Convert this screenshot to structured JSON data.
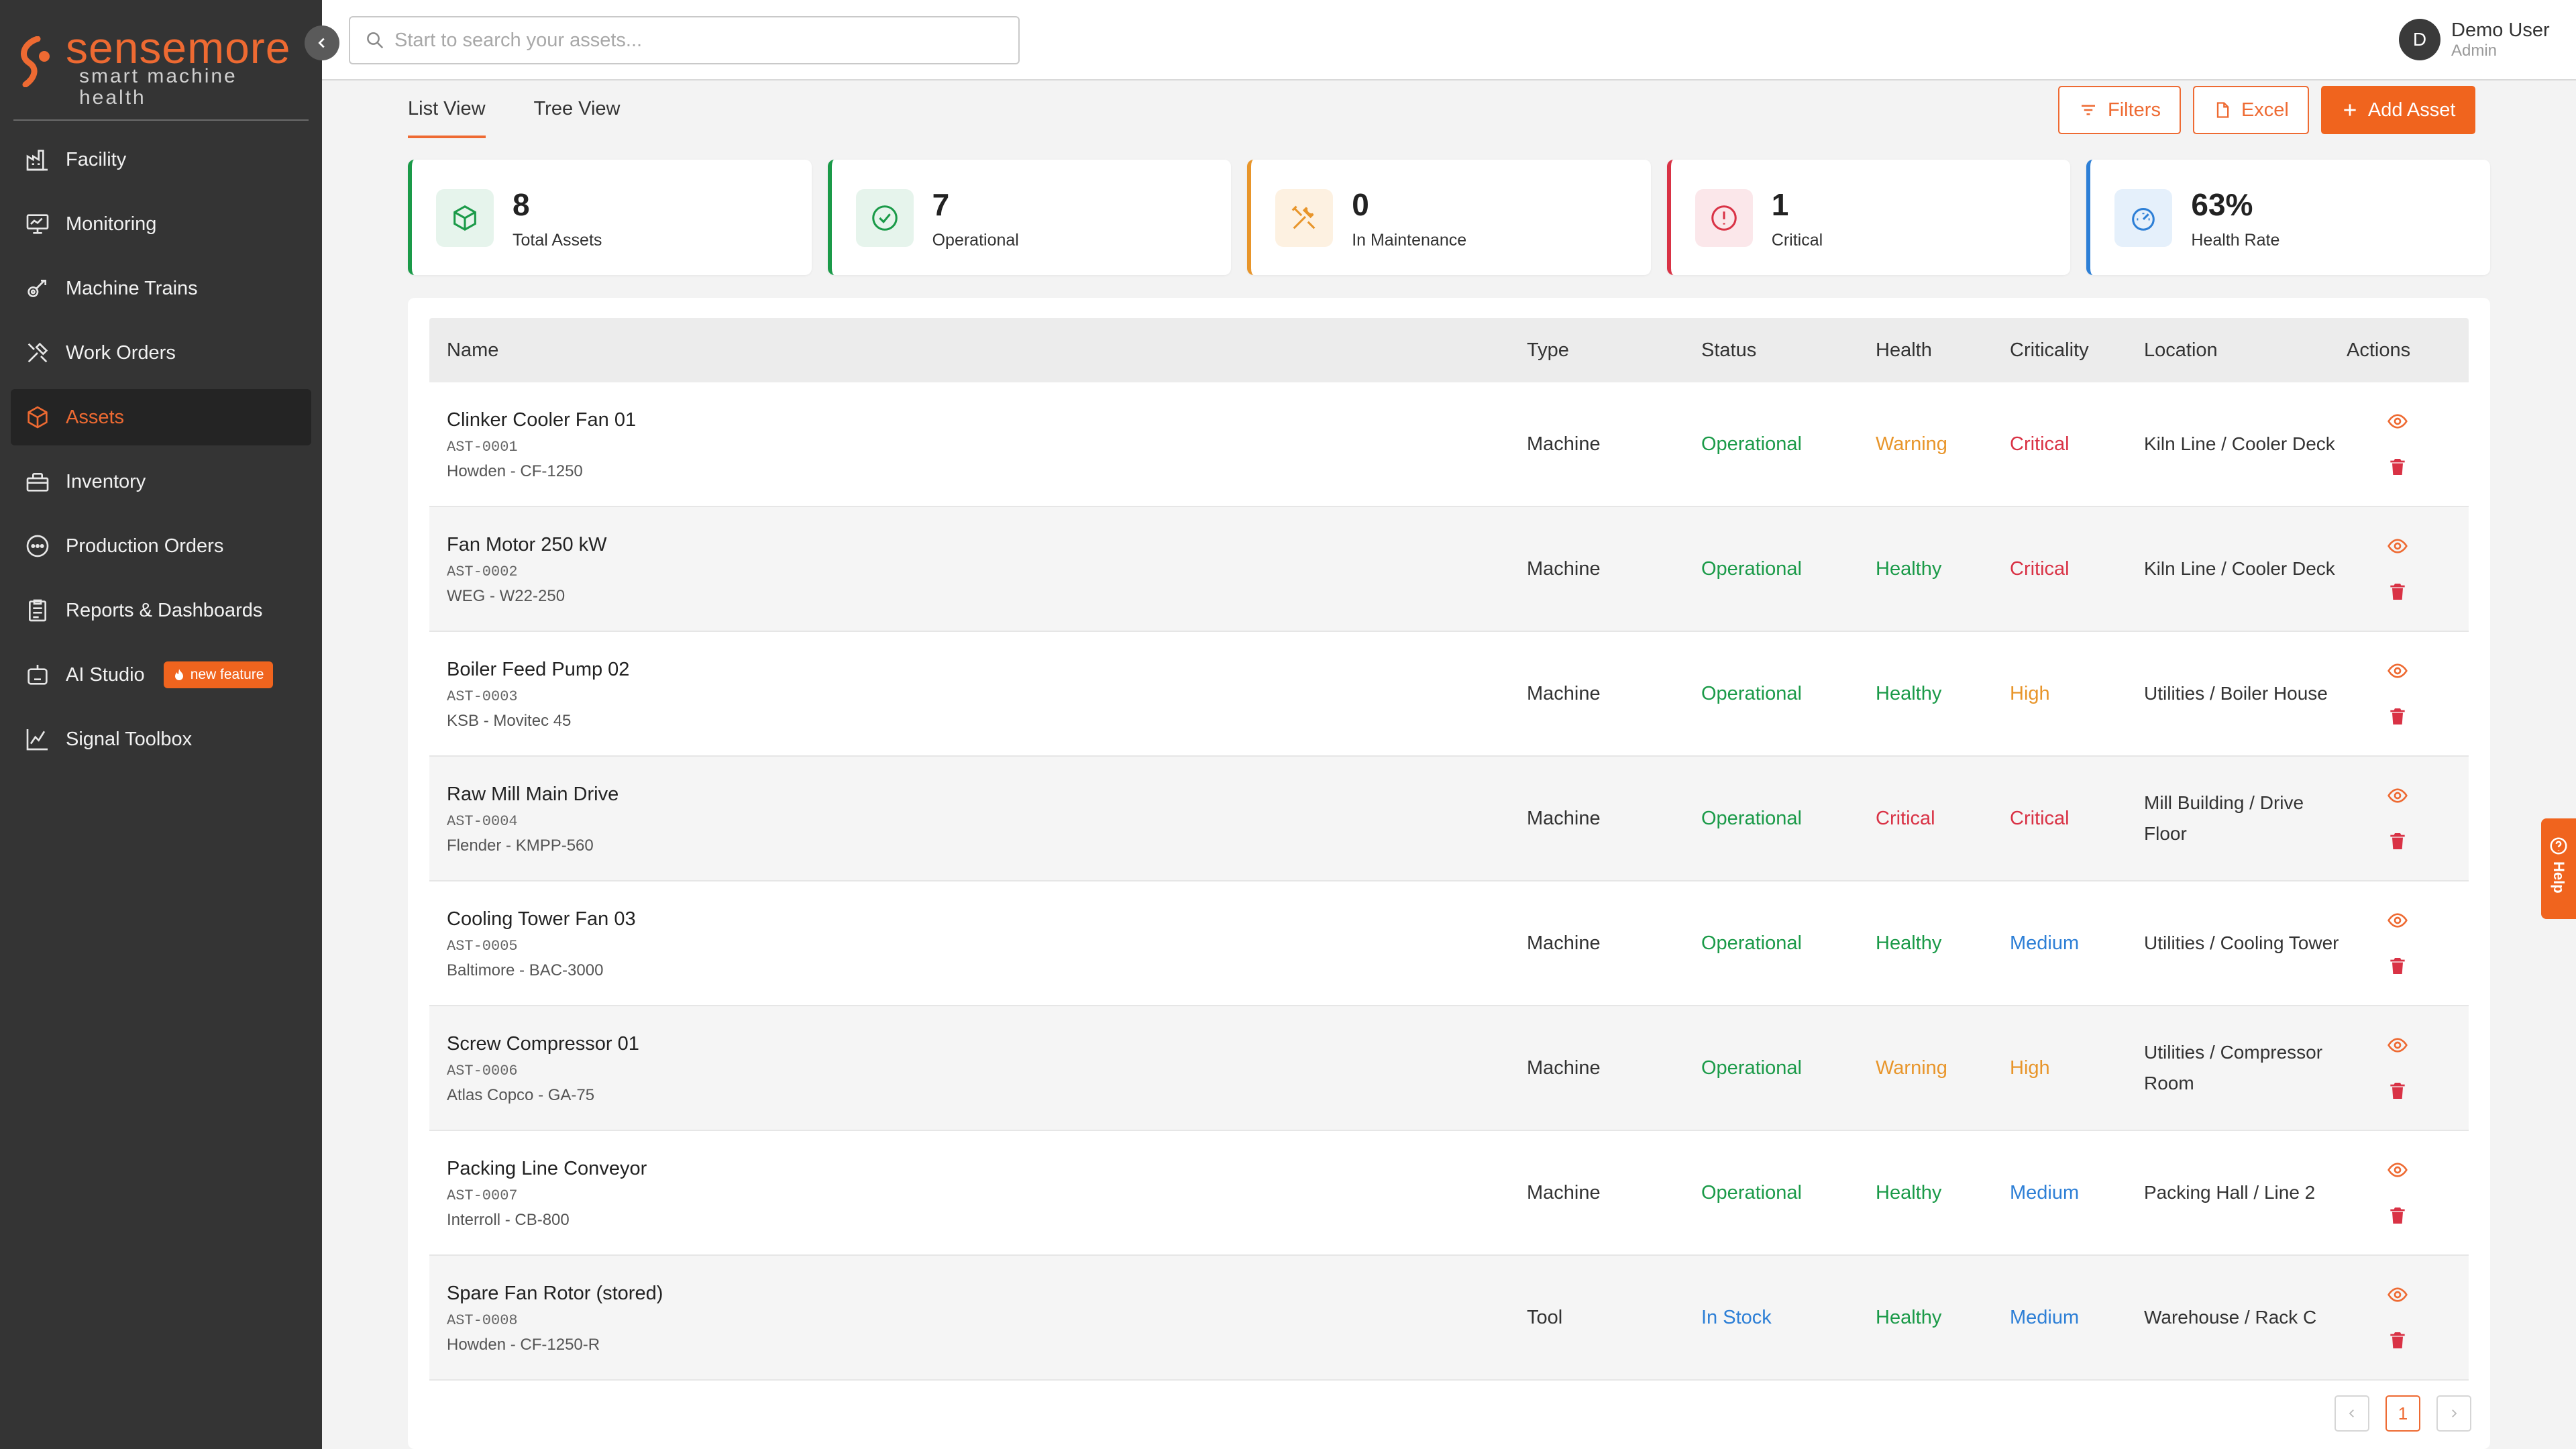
{
  "brand": {
    "name": "sensemore",
    "tagline": "smart machine health",
    "accent": "#ee6a32"
  },
  "sidebar": {
    "items": [
      {
        "label": "Facility",
        "icon": "facility-icon",
        "active": false
      },
      {
        "label": "Monitoring",
        "icon": "monitoring-icon",
        "active": false
      },
      {
        "label": "Machine Trains",
        "icon": "machine-trains-icon",
        "active": false
      },
      {
        "label": "Work Orders",
        "icon": "work-orders-icon",
        "active": false
      },
      {
        "label": "Assets",
        "icon": "box-icon",
        "active": true
      },
      {
        "label": "Inventory",
        "icon": "inventory-icon",
        "active": false
      },
      {
        "label": "Production Orders",
        "icon": "production-icon",
        "active": false
      },
      {
        "label": "Reports & Dashboards",
        "icon": "clipboard-icon",
        "active": false
      },
      {
        "label": "AI Studio",
        "icon": "robot-icon",
        "active": false,
        "badge": "new feature"
      },
      {
        "label": "Signal Toolbox",
        "icon": "chart-icon",
        "active": false
      }
    ]
  },
  "search": {
    "placeholder": "Start to search your assets..."
  },
  "user": {
    "initial": "D",
    "name": "Demo User",
    "role": "Admin"
  },
  "tabs": [
    {
      "label": "List View",
      "active": true
    },
    {
      "label": "Tree View",
      "active": false
    }
  ],
  "toolbar": {
    "filters": "Filters",
    "excel": "Excel",
    "add": "Add Asset"
  },
  "stats": [
    {
      "value": "8",
      "label": "Total Assets",
      "color": "#1a9a48",
      "icon": "cube-icon"
    },
    {
      "value": "7",
      "label": "Operational",
      "color": "#1a9a48",
      "icon": "check-circle-icon"
    },
    {
      "value": "0",
      "label": "In Maintenance",
      "color": "#e8952a",
      "icon": "tools-icon"
    },
    {
      "value": "1",
      "label": "Critical",
      "color": "#d93245",
      "icon": "alert-circle-icon"
    },
    {
      "value": "63%",
      "label": "Health Rate",
      "color": "#2d7fd6",
      "icon": "gauge-icon"
    }
  ],
  "table": {
    "columns": [
      "Name",
      "Type",
      "Status",
      "Health",
      "Criticality",
      "Location",
      "Actions"
    ],
    "rows": [
      {
        "name": "Clinker Cooler Fan 01",
        "code": "AST-0001",
        "model": "Howden - CF-1250",
        "type": "Machine",
        "status": "Operational",
        "health": "Warning",
        "criticality": "Critical",
        "location": "Kiln Line / Cooler Deck"
      },
      {
        "name": "Fan Motor 250 kW",
        "code": "AST-0002",
        "model": "WEG - W22-250",
        "type": "Machine",
        "status": "Operational",
        "health": "Healthy",
        "criticality": "Critical",
        "location": "Kiln Line / Cooler Deck"
      },
      {
        "name": "Boiler Feed Pump 02",
        "code": "AST-0003",
        "model": "KSB - Movitec 45",
        "type": "Machine",
        "status": "Operational",
        "health": "Healthy",
        "criticality": "High",
        "location": "Utilities / Boiler House"
      },
      {
        "name": "Raw Mill Main Drive",
        "code": "AST-0004",
        "model": "Flender - KMPP-560",
        "type": "Machine",
        "status": "Operational",
        "health": "Critical",
        "criticality": "Critical",
        "location": "Mill Building / Drive Floor"
      },
      {
        "name": "Cooling Tower Fan 03",
        "code": "AST-0005",
        "model": "Baltimore - BAC-3000",
        "type": "Machine",
        "status": "Operational",
        "health": "Healthy",
        "criticality": "Medium",
        "location": "Utilities / Cooling Tower"
      },
      {
        "name": "Screw Compressor 01",
        "code": "AST-0006",
        "model": "Atlas Copco - GA-75",
        "type": "Machine",
        "status": "Operational",
        "health": "Warning",
        "criticality": "High",
        "location": "Utilities / Compressor Room"
      },
      {
        "name": "Packing Line Conveyor",
        "code": "AST-0007",
        "model": "Interroll - CB-800",
        "type": "Machine",
        "status": "Operational",
        "health": "Healthy",
        "criticality": "Medium",
        "location": "Packing Hall / Line 2"
      },
      {
        "name": "Spare Fan Rotor (stored)",
        "code": "AST-0008",
        "model": "Howden - CF-1250-R",
        "type": "Tool",
        "status": "In Stock",
        "health": "Healthy",
        "criticality": "Medium",
        "location": "Warehouse / Rack C"
      }
    ]
  },
  "pagination": {
    "current": "1"
  },
  "help": {
    "label": "Help"
  }
}
